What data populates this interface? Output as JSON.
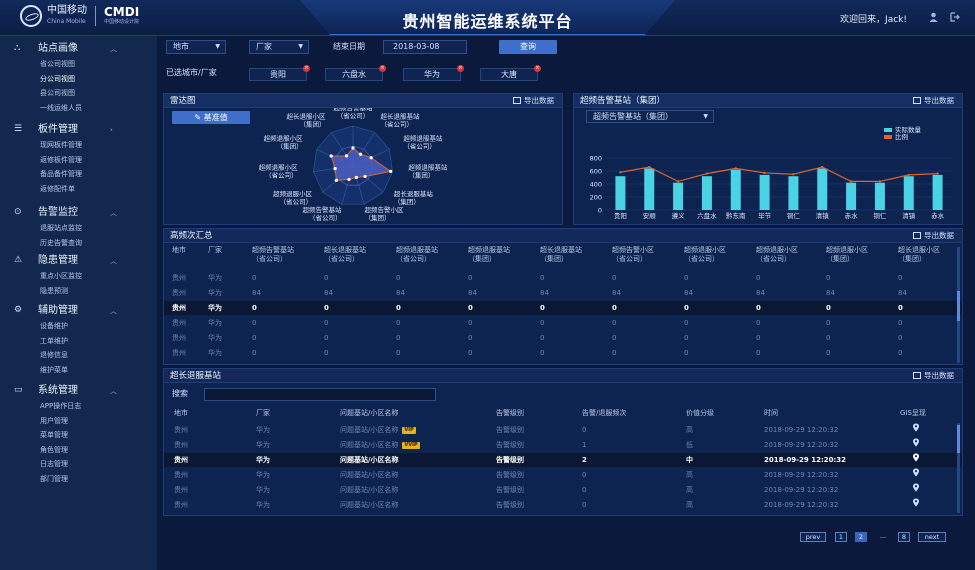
{
  "header": {
    "logo_cn": "中国移动",
    "logo_en": "China Mobile",
    "cmdi_title": "CMDI",
    "cmdi_sub": "中国移动设计院",
    "title": "贵州智能运维系统平台",
    "welcome": "欢迎回来，Jack!",
    "icons": [
      "user-icon",
      "logout-icon"
    ]
  },
  "sidebar": [
    {
      "icon": "tree-icon",
      "title": "站点画像",
      "expanded": true,
      "items": [
        "省公司视图",
        "分公司视图",
        "县公司视图",
        "一线运维人员"
      ],
      "active_item": 1
    },
    {
      "icon": "layers-icon",
      "title": "板件管理",
      "expanded": false,
      "items": [
        "现网板件管理",
        "返修板件管理",
        "备品备件管理",
        "返修配件单"
      ]
    },
    {
      "icon": "alarm-icon",
      "title": "告警监控",
      "expanded": true,
      "items": [
        "退服站点监控",
        "历史告警查询"
      ]
    },
    {
      "icon": "warning-icon",
      "title": "隐患管理",
      "expanded": true,
      "items": [
        "重点小区监控",
        "隐患预测"
      ]
    },
    {
      "icon": "gear-icon",
      "title": "辅助管理",
      "expanded": true,
      "items": [
        "设备维护",
        "工单维护",
        "退修信息",
        "维护菜单"
      ]
    },
    {
      "icon": "monitor-icon",
      "title": "系统管理",
      "expanded": true,
      "items": [
        "APP操作日志",
        "用户管理",
        "菜单管理",
        "角色管理",
        "日志管理",
        "部门管理"
      ]
    }
  ],
  "filters": {
    "city": "地市",
    "vendor": "厂家",
    "end_date_label": "结束日期",
    "end_date": "2018-03-08",
    "query": "查询",
    "selected_label": "已选城市/厂家",
    "tags": [
      "贵阳",
      "六盘水",
      "华为",
      "大唐"
    ]
  },
  "radar": {
    "title": "雷达图",
    "export": "导出数据",
    "baseline_btn": "基准值",
    "axes": [
      [
        "超频告警基站",
        "（省公司）"
      ],
      [
        "超长退服基站",
        "（省公司）"
      ],
      [
        "超频退服基站",
        "（省公司）"
      ],
      [
        "超频退服基站",
        "（集团）"
      ],
      [
        "超长退服基站",
        "（集团）"
      ],
      [
        "超频告警小区",
        "（集团）"
      ],
      [
        "超频告警基站",
        "（省公司）"
      ],
      [
        "超频退服小区",
        "（省公司）"
      ],
      [
        "超频退服小区",
        "（省公司）"
      ],
      [
        "超频退服小区",
        "（集团）"
      ],
      [
        "超长退服小区",
        "（集团）"
      ]
    ],
    "values": [
      0.45,
      0.35,
      0.5,
      0.95,
      0.4,
      0.3,
      0.35,
      0.55,
      0.45,
      0.6,
      0.3
    ],
    "baseline": [
      0.5,
      0.5,
      0.5,
      0.5,
      0.5,
      0.5,
      0.5,
      0.5,
      0.5,
      0.5,
      0.5
    ],
    "colors": {
      "value": "#4a5fc0",
      "baseline": "#e0642b"
    }
  },
  "bar_panel": {
    "title": "超频告警基站（集团）",
    "export": "导出数据",
    "select_value": "超频告警基站（集团）"
  },
  "chart_data": {
    "type": "bar",
    "categories": [
      "贵阳",
      "安顺",
      "遵义",
      "六盘水",
      "黔东南",
      "毕节",
      "铜仁",
      "清镇",
      "赤水",
      "铜仁",
      "清镇",
      "赤水"
    ],
    "series": [
      {
        "name": "实际数量",
        "type": "bar",
        "values": [
          520,
          640,
          420,
          520,
          620,
          540,
          520,
          640,
          420,
          420,
          520,
          540
        ],
        "color": "#49d3e4"
      },
      {
        "name": "比例",
        "type": "line",
        "values": [
          580,
          660,
          440,
          560,
          640,
          570,
          550,
          660,
          440,
          440,
          540,
          560
        ],
        "color": "#e0642b"
      }
    ],
    "ylim": [
      0,
      800
    ],
    "yticks": [
      0,
      200,
      400,
      600,
      800
    ],
    "legend_position": "top-right"
  },
  "freq_table": {
    "title": "高频次汇总",
    "export": "导出数据",
    "headers": [
      [
        "地市",
        ""
      ],
      [
        "厂家",
        ""
      ],
      [
        "超频告警基站",
        "（省公司）"
      ],
      [
        "超长退服基站",
        "（省公司）"
      ],
      [
        "超频退服基站",
        "（省公司）"
      ],
      [
        "超频退服基站",
        "（集团）"
      ],
      [
        "超长退服基站",
        "（集团）"
      ],
      [
        "超频告警小区",
        "（省公司）"
      ],
      [
        "超频退服小区",
        "（省公司）"
      ],
      [
        "超频退服小区",
        "（省公司）"
      ],
      [
        "超频退服小区",
        "（集团）"
      ],
      [
        "超长退服小区",
        "（集团）"
      ]
    ],
    "rows": [
      [
        "贵州",
        "华为",
        "0",
        "0",
        "0",
        "0",
        "0",
        "0",
        "0",
        "0",
        "0",
        "0"
      ],
      [
        "贵州",
        "华为",
        "84",
        "84",
        "84",
        "84",
        "84",
        "84",
        "84",
        "84",
        "84",
        "84"
      ],
      [
        "贵州",
        "华为",
        "0",
        "0",
        "0",
        "0",
        "0",
        "0",
        "0",
        "0",
        "0",
        "0"
      ],
      [
        "贵州",
        "华为",
        "0",
        "0",
        "0",
        "0",
        "0",
        "0",
        "0",
        "0",
        "0",
        "0"
      ],
      [
        "贵州",
        "华为",
        "0",
        "0",
        "0",
        "0",
        "0",
        "0",
        "0",
        "0",
        "0",
        "0"
      ],
      [
        "贵州",
        "华为",
        "0",
        "0",
        "0",
        "0",
        "0",
        "0",
        "0",
        "0",
        "0",
        "0"
      ]
    ],
    "highlight": 2
  },
  "station_table": {
    "title": "超长退服基站",
    "export": "导出数据",
    "search_label": "搜索",
    "search_value": "",
    "headers": [
      "地市",
      "厂家",
      "问题基站/小区名称",
      "告警级别",
      "告警/退服频次",
      "价值分级",
      "时间",
      "GIS呈现"
    ],
    "rows": [
      [
        "贵州",
        "华为",
        "问题基站/小区名称",
        "告警级别",
        "0",
        "高",
        "2018-09-29 12:20:32",
        "VIP"
      ],
      [
        "贵州",
        "华为",
        "问题基站/小区名称",
        "告警级别",
        "1",
        "低",
        "2018-09-29 12:20:32",
        "VVIP"
      ],
      [
        "贵州",
        "华为",
        "问题基站/小区名称",
        "告警级别",
        "2",
        "中",
        "2018-09-29 12:20:32",
        ""
      ],
      [
        "贵州",
        "华为",
        "问题基站/小区名称",
        "告警级别",
        "0",
        "高",
        "2018-09-29 12:20:32",
        ""
      ],
      [
        "贵州",
        "华为",
        "问题基站/小区名称",
        "告警级别",
        "0",
        "高",
        "2018-09-29 12:20:32",
        ""
      ],
      [
        "贵州",
        "华为",
        "问题基站/小区名称",
        "告警级别",
        "0",
        "高",
        "2018-09-29 12:20:32",
        ""
      ]
    ],
    "highlight": 2,
    "gis_icon": "map-pin-icon"
  },
  "pagination": {
    "prev": "prev",
    "pages": [
      "1",
      "2",
      "...",
      "8"
    ],
    "current": "2",
    "next": "next"
  }
}
